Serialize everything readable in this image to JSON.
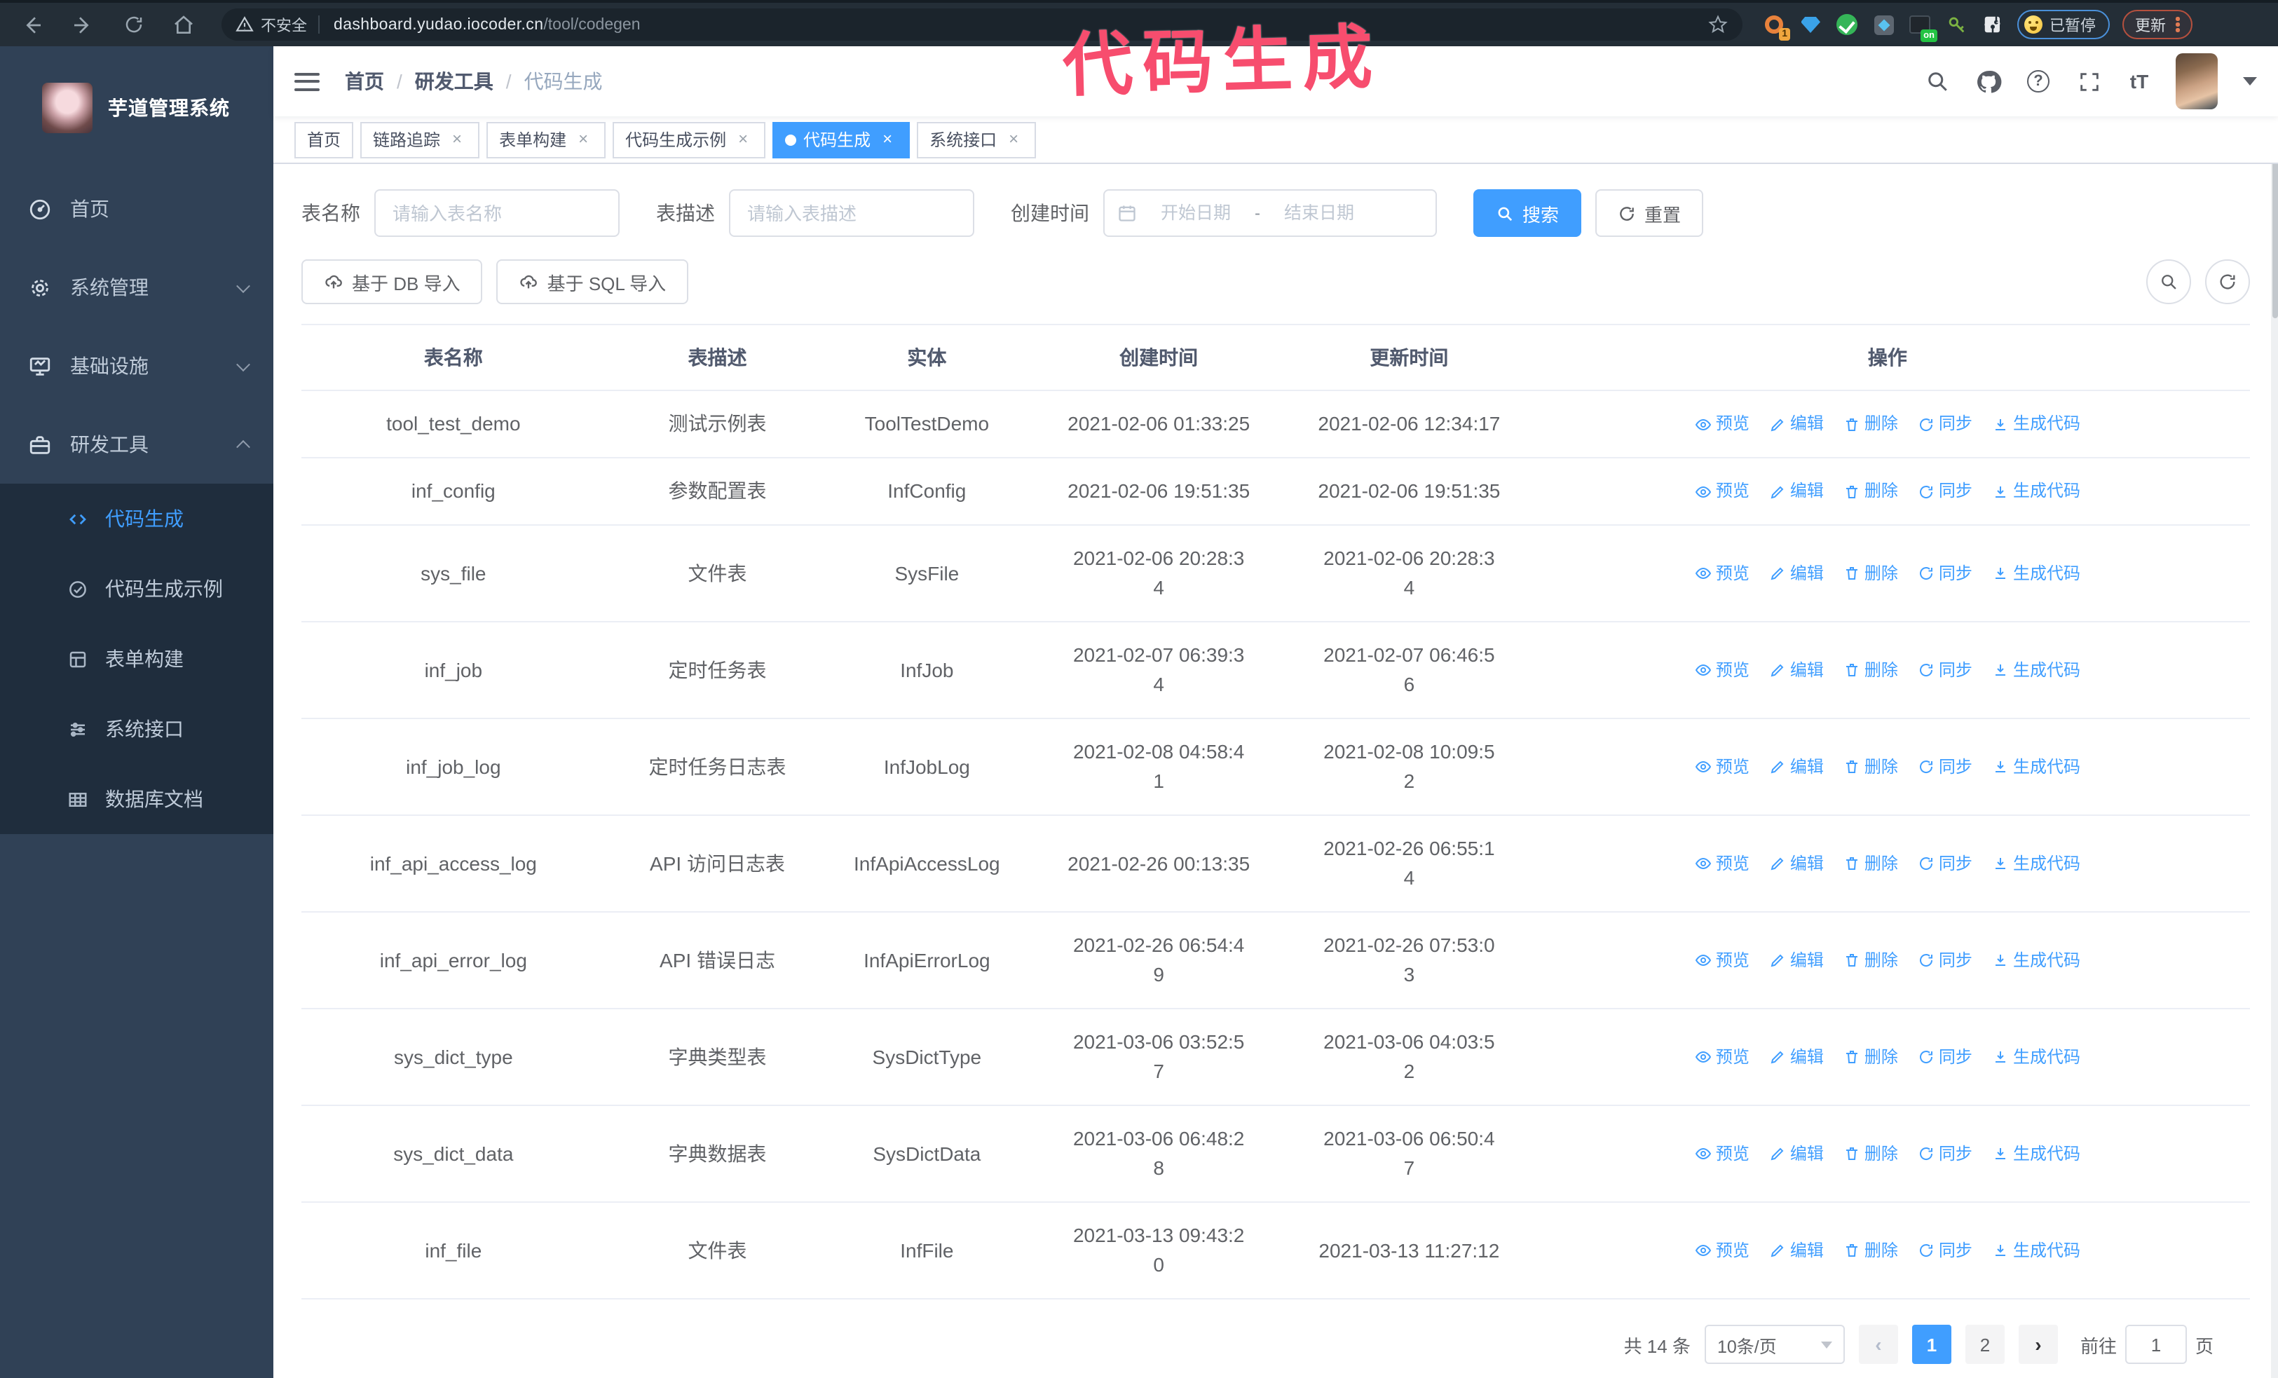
{
  "annotation": {
    "text": "代码生成",
    "color": "#f74d6e"
  },
  "browser": {
    "security_label": "不安全",
    "url_host": "dashboard.yudao.iocoder.cn",
    "url_path": "/tool/codegen",
    "ext_badge_1": "1",
    "ext_on_badge": "on",
    "paused_label": "已暂停",
    "update_label": "更新"
  },
  "sidebar": {
    "logo_title": "芋道管理系统",
    "items": [
      {
        "label": "首页"
      },
      {
        "label": "系统管理"
      },
      {
        "label": "基础设施"
      },
      {
        "label": "研发工具"
      }
    ],
    "submenu": [
      {
        "label": "代码生成"
      },
      {
        "label": "代码生成示例"
      },
      {
        "label": "表单构建"
      },
      {
        "label": "系统接口"
      },
      {
        "label": "数据库文档"
      }
    ]
  },
  "header": {
    "breadcrumb": [
      "首页",
      "研发工具",
      "代码生成"
    ]
  },
  "tags": [
    {
      "label": "首页"
    },
    {
      "label": "链路追踪"
    },
    {
      "label": "表单构建"
    },
    {
      "label": "代码生成示例"
    },
    {
      "label": "代码生成"
    },
    {
      "label": "系统接口"
    }
  ],
  "filters": {
    "name_label": "表名称",
    "name_placeholder": "请输入表名称",
    "desc_label": "表描述",
    "desc_placeholder": "请输入表描述",
    "time_label": "创建时间",
    "start_placeholder": "开始日期",
    "range_separator": "-",
    "end_placeholder": "结束日期",
    "search_label": "搜索",
    "reset_label": "重置"
  },
  "toolbar": {
    "import_db_label": "基于 DB 导入",
    "import_sql_label": "基于 SQL 导入"
  },
  "table": {
    "columns": [
      "表名称",
      "表描述",
      "实体",
      "创建时间",
      "更新时间",
      "操作"
    ],
    "actions": [
      "预览",
      "编辑",
      "删除",
      "同步",
      "生成代码"
    ],
    "rows": [
      {
        "name": "tool_test_demo",
        "desc": "测试示例表",
        "entity": "ToolTestDemo",
        "created": "2021-02-06 01:33:25",
        "updated": "2021-02-06 12:34:17"
      },
      {
        "name": "inf_config",
        "desc": "参数配置表",
        "entity": "InfConfig",
        "created": "2021-02-06 19:51:35",
        "updated": "2021-02-06 19:51:35"
      },
      {
        "name": "sys_file",
        "desc": "文件表",
        "entity": "SysFile",
        "created": "2021-02-06 20:28:3\n4",
        "updated": "2021-02-06 20:28:3\n4"
      },
      {
        "name": "inf_job",
        "desc": "定时任务表",
        "entity": "InfJob",
        "created": "2021-02-07 06:39:3\n4",
        "updated": "2021-02-07 06:46:5\n6"
      },
      {
        "name": "inf_job_log",
        "desc": "定时任务日志表",
        "entity": "InfJobLog",
        "created": "2021-02-08 04:58:4\n1",
        "updated": "2021-02-08 10:09:5\n2"
      },
      {
        "name": "inf_api_access_log",
        "desc": "API 访问日志表",
        "entity": "InfApiAccessLog",
        "created": "2021-02-26 00:13:35",
        "updated": "2021-02-26 06:55:1\n4"
      },
      {
        "name": "inf_api_error_log",
        "desc": "API 错误日志",
        "entity": "InfApiErrorLog",
        "created": "2021-02-26 06:54:4\n9",
        "updated": "2021-02-26 07:53:0\n3"
      },
      {
        "name": "sys_dict_type",
        "desc": "字典类型表",
        "entity": "SysDictType",
        "created": "2021-03-06 03:52:5\n7",
        "updated": "2021-03-06 04:03:5\n2"
      },
      {
        "name": "sys_dict_data",
        "desc": "字典数据表",
        "entity": "SysDictData",
        "created": "2021-03-06 06:48:2\n8",
        "updated": "2021-03-06 06:50:4\n7"
      },
      {
        "name": "inf_file",
        "desc": "文件表",
        "entity": "InfFile",
        "created": "2021-03-13 09:43:2\n0",
        "updated": "2021-03-13 11:27:12"
      }
    ]
  },
  "pagination": {
    "total_label": "共 14 条",
    "page_size": "10条/页",
    "prev": "‹",
    "next": "›",
    "pages": [
      "1",
      "2"
    ],
    "goto_label": "前往",
    "goto_value": "1",
    "page_unit": "页"
  },
  "colors": {
    "accent": "#409eff",
    "annotation_pink": "#f74d6e",
    "sidebar_bg": "#304156",
    "submenu_bg": "#1f2d3d"
  }
}
